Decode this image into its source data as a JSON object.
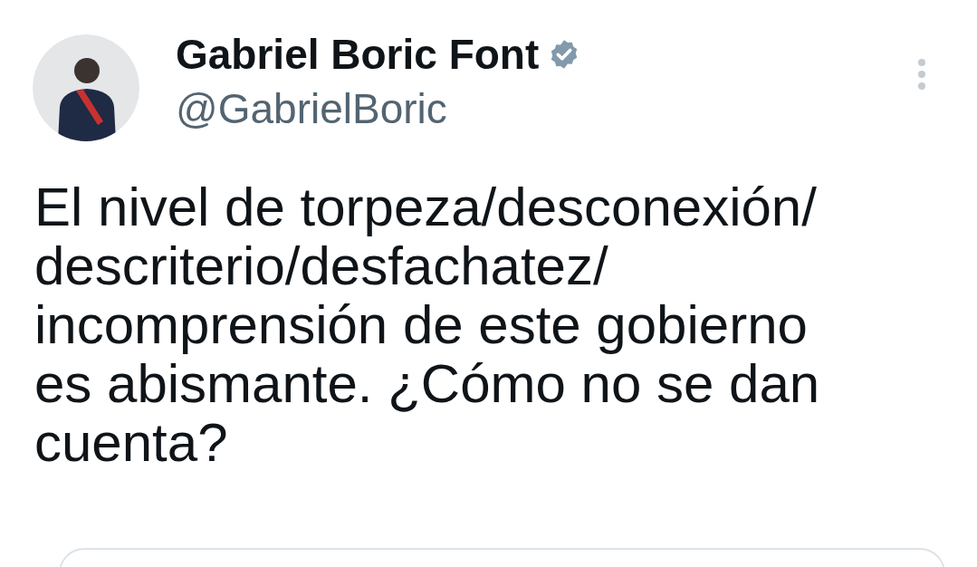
{
  "author": {
    "name": "Gabriel Boric Font",
    "verified": true,
    "handle": "@GabrielBoric"
  },
  "tweet": {
    "text": "El nivel de torpeza/desconexión/\ndescriterio/desfachatez/\nincomprensión de este gobierno\nes abismante. ¿Cómo no se dan\ncuenta?"
  }
}
